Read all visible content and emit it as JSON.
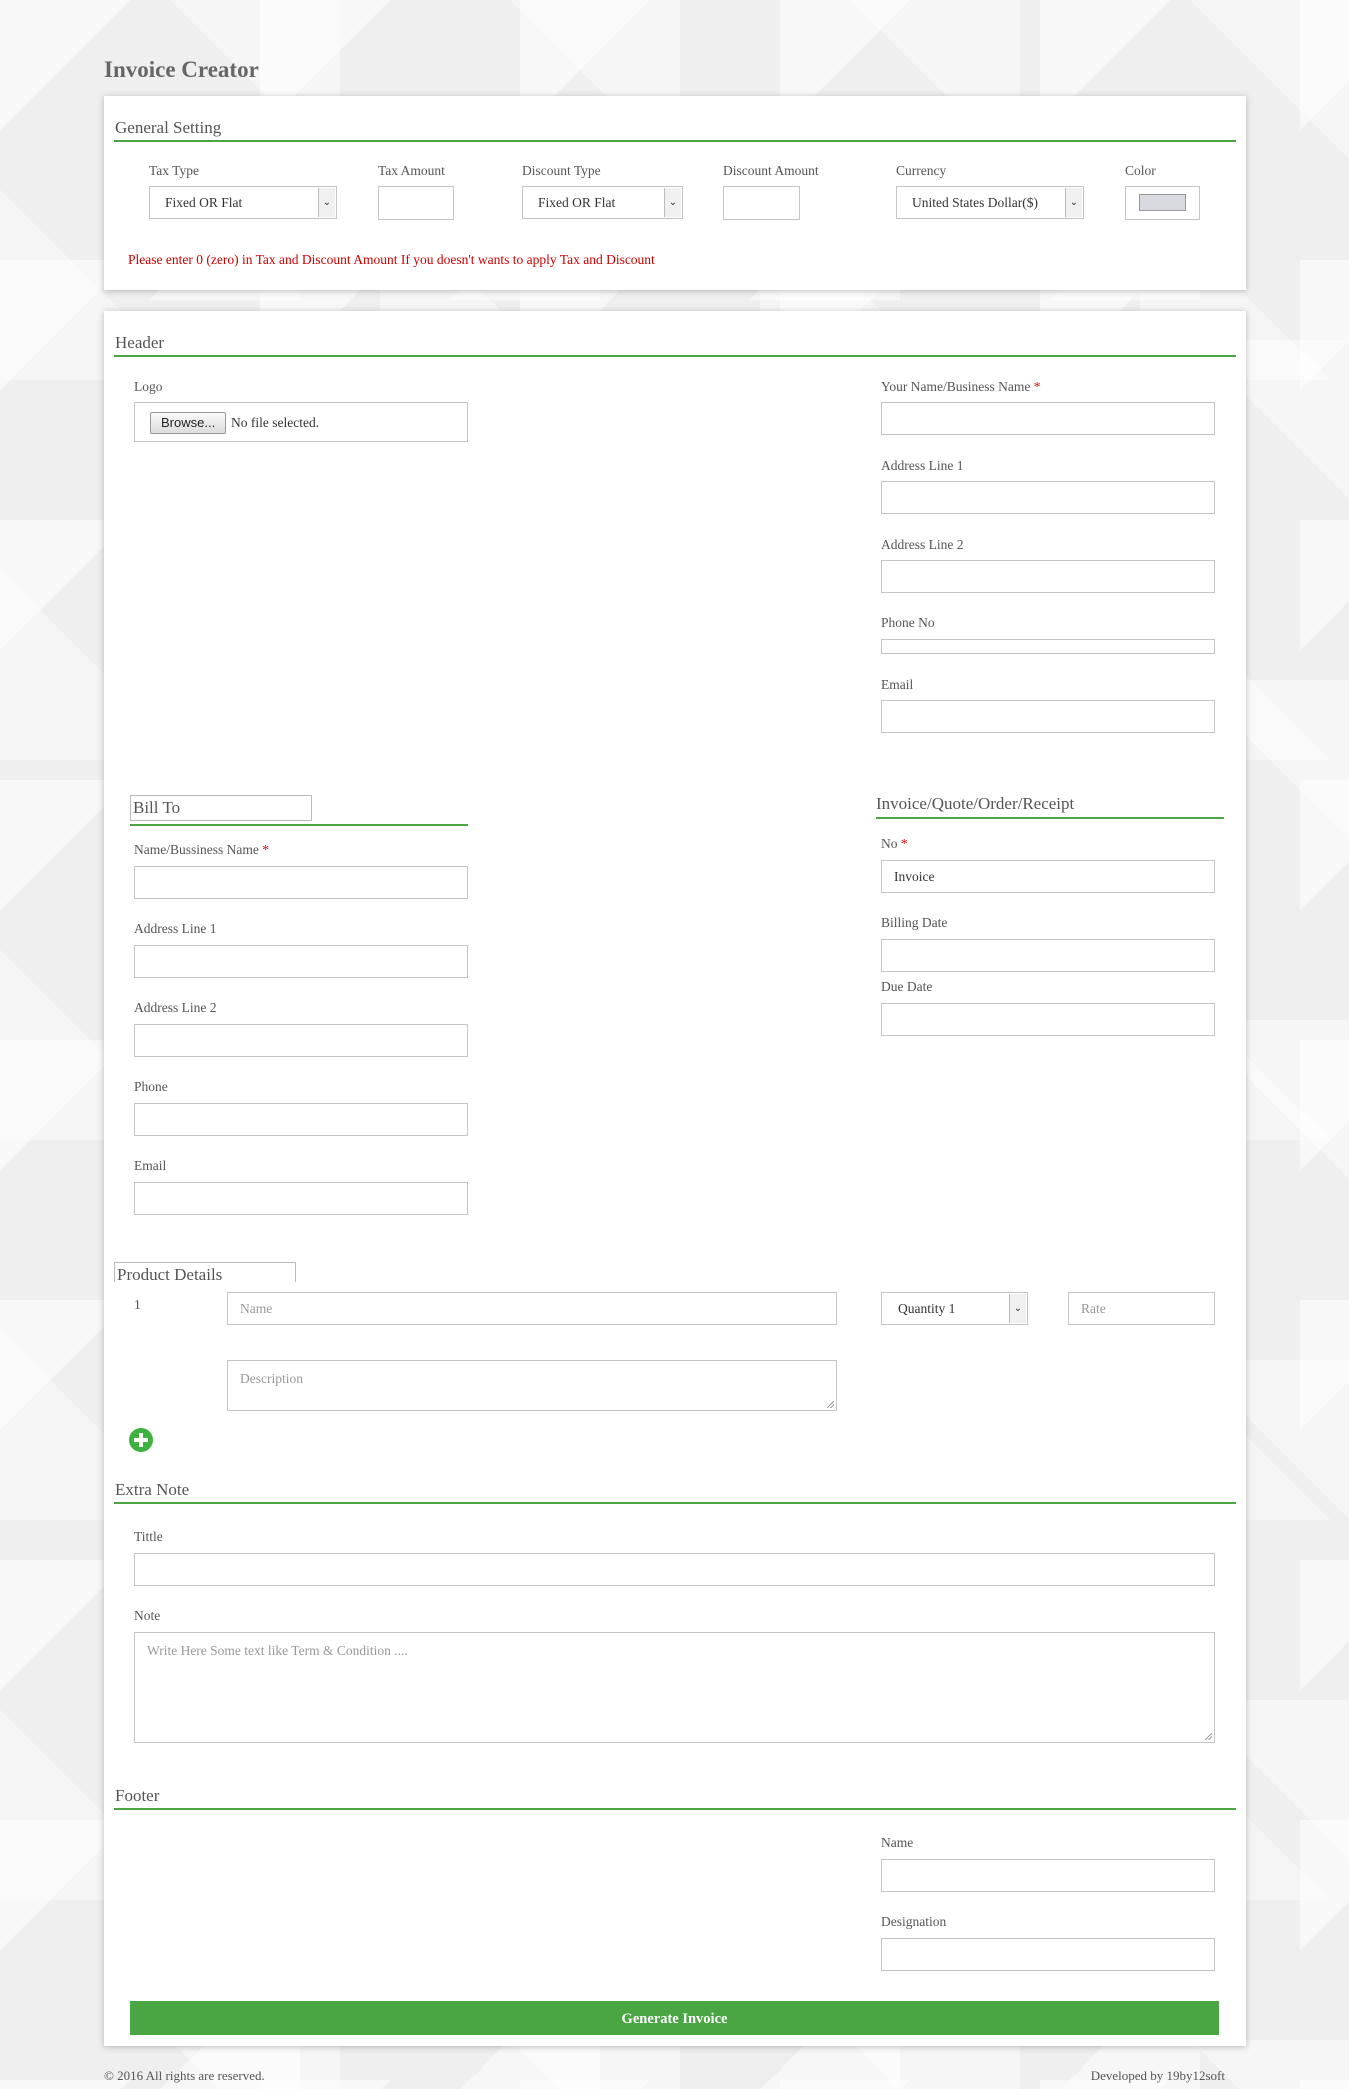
{
  "app": {
    "title": "Invoice Creator"
  },
  "general": {
    "section_title": "General Setting",
    "tax_type_label": "Tax Type",
    "tax_type_value": "Fixed OR Flat",
    "tax_amount_label": "Tax Amount",
    "discount_type_label": "Discount Type",
    "discount_type_value": "Fixed OR Flat",
    "discount_amount_label": "Discount Amount",
    "currency_label": "Currency",
    "currency_value": "United States Dollar($)",
    "color_label": "Color",
    "color_value": "#d8dadf",
    "warning": "Please enter 0 (zero) in Tax and Discount Amount If you doesn't wants to apply Tax and Discount"
  },
  "header": {
    "section_title": "Header",
    "logo_label": "Logo",
    "browse_label": "Browse...",
    "no_file": "No file selected.",
    "name_label": "Your Name/Business Name",
    "required_mark": "*",
    "address1_label": "Address Line 1",
    "address2_label": "Address Line 2",
    "phone_label": "Phone No",
    "email_label": "Email"
  },
  "bill_to": {
    "section_title": "Bill To",
    "name_label": "Name/Bussiness Name",
    "required_mark": "*",
    "address1_label": "Address Line 1",
    "address2_label": "Address Line 2",
    "phone_label": "Phone",
    "email_label": "Email"
  },
  "invoice": {
    "section_title": "Invoice/Quote/Order/Receipt",
    "no_label": "No",
    "required_mark": "*",
    "no_value": "Invoice",
    "billing_date_label": "Billing Date",
    "due_date_label": "Due Date"
  },
  "products": {
    "section_title": "Product Details",
    "rows": [
      {
        "index": "1",
        "name_placeholder": "Name",
        "quantity_value": "Quantity 1",
        "rate_placeholder": "Rate",
        "description_placeholder": "Description"
      }
    ],
    "add_icon": "plus-circle-icon"
  },
  "extra_note": {
    "section_title": "Extra Note",
    "title_label": "Tittle",
    "note_label": "Note",
    "note_placeholder": "Write Here Some text like Term & Condition ...."
  },
  "footer_section": {
    "section_title": "Footer",
    "name_label": "Name",
    "designation_label": "Designation"
  },
  "actions": {
    "generate_label": "Generate Invoice"
  },
  "page_footer": {
    "copyright": "© 2016 All rights are reserved.",
    "developer": "Developed by 19by12soft"
  },
  "colors": {
    "accent": "#4aa543",
    "warning": "#cc0000",
    "required": "#d01010"
  }
}
